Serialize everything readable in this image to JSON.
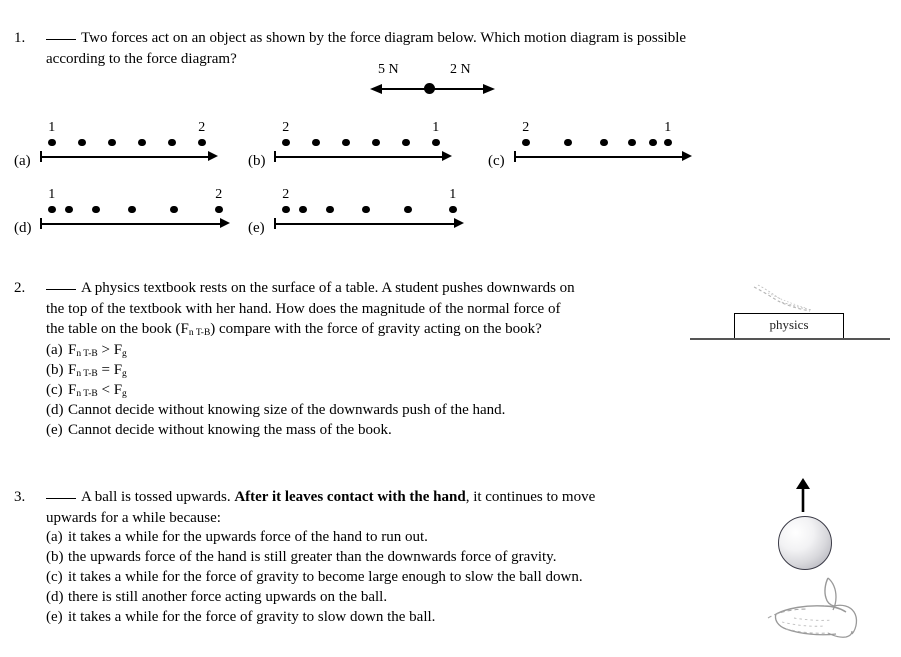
{
  "document": {
    "type": "physics-worksheet"
  },
  "questions": [
    {
      "number": "1.",
      "text_part1": "Two forces act on an object as shown by the force diagram below. Which motion diagram is possible",
      "text_part2": "according to the force diagram?"
    },
    {
      "number": "2.",
      "text_line1": "A physics textbook rests on the surface of a table. A student pushes downwards on",
      "text_line2": "the top of the textbook with her hand. How does the magnitude of the normal force of",
      "text_line3_a": "the table on the book (F",
      "text_line3_sub": "n T-B",
      "text_line3_b": ") compare with the force of gravity acting on the book?",
      "options": [
        {
          "label": "(a)",
          "sym": "F",
          "sub": "n T-B",
          "rel": ">",
          "sym2": "F",
          "sub2": "g"
        },
        {
          "label": "(b)",
          "sym": "F",
          "sub": "n T-B",
          "rel": "=",
          "sym2": "F",
          "sub2": "g"
        },
        {
          "label": "(c)",
          "sym": "F",
          "sub": "n T-B",
          "rel": "<",
          "sym2": "F",
          "sub2": "g"
        },
        {
          "label": "(d)",
          "text": "Cannot decide without knowing size of the downwards push of the hand."
        },
        {
          "label": "(e)",
          "text": "Cannot decide without knowing the mass of the book."
        }
      ]
    },
    {
      "number": "3.",
      "text_pre": "A ball is tossed upwards. ",
      "text_bold": "After it leaves contact with the hand",
      "text_post": ", it continues to move",
      "text_line2": "upwards for a while because:",
      "options": [
        {
          "label": "(a)",
          "text": "it takes a while for the upwards force of the hand to run out."
        },
        {
          "label": "(b)",
          "text": "the upwards force of the hand is still greater than the downwards force of gravity."
        },
        {
          "label": "(c)",
          "text": "it takes a while for the force of gravity to become large enough to slow the ball down."
        },
        {
          "label": "(d)",
          "text": "there is still another force acting upwards on the ball."
        },
        {
          "label": "(e)",
          "text": "it takes a while for the force of gravity to slow down the ball."
        }
      ]
    }
  ],
  "force_diagram": {
    "left_force_label": "5 N",
    "right_force_label": "2 N"
  },
  "motion_diagrams": [
    {
      "letter": "(a)",
      "start_label": "1",
      "end_label": "2",
      "spacing": "uniform",
      "dot_positions": [
        8,
        38,
        68,
        98,
        128,
        158
      ],
      "axis_width": 178
    },
    {
      "letter": "(b)",
      "start_label": "2",
      "end_label": "1",
      "spacing": "uniform",
      "dot_positions": [
        8,
        38,
        68,
        98,
        128,
        158
      ],
      "axis_width": 178
    },
    {
      "letter": "(c)",
      "start_label": "2",
      "end_label": "1",
      "spacing": "decreasing",
      "dot_positions": [
        8,
        50,
        86,
        114,
        135,
        150
      ],
      "axis_width": 178
    },
    {
      "letter": "(d)",
      "start_label": "1",
      "end_label": "2",
      "spacing": "increasing",
      "dot_positions": [
        8,
        25,
        52,
        88,
        130,
        175
      ],
      "axis_width": 190
    },
    {
      "letter": "(e)",
      "start_label": "2",
      "end_label": "1",
      "spacing": "increasing",
      "dot_positions": [
        8,
        25,
        52,
        88,
        130,
        175
      ],
      "axis_width": 190
    }
  ],
  "book_illustration": {
    "book_label": "physics"
  }
}
